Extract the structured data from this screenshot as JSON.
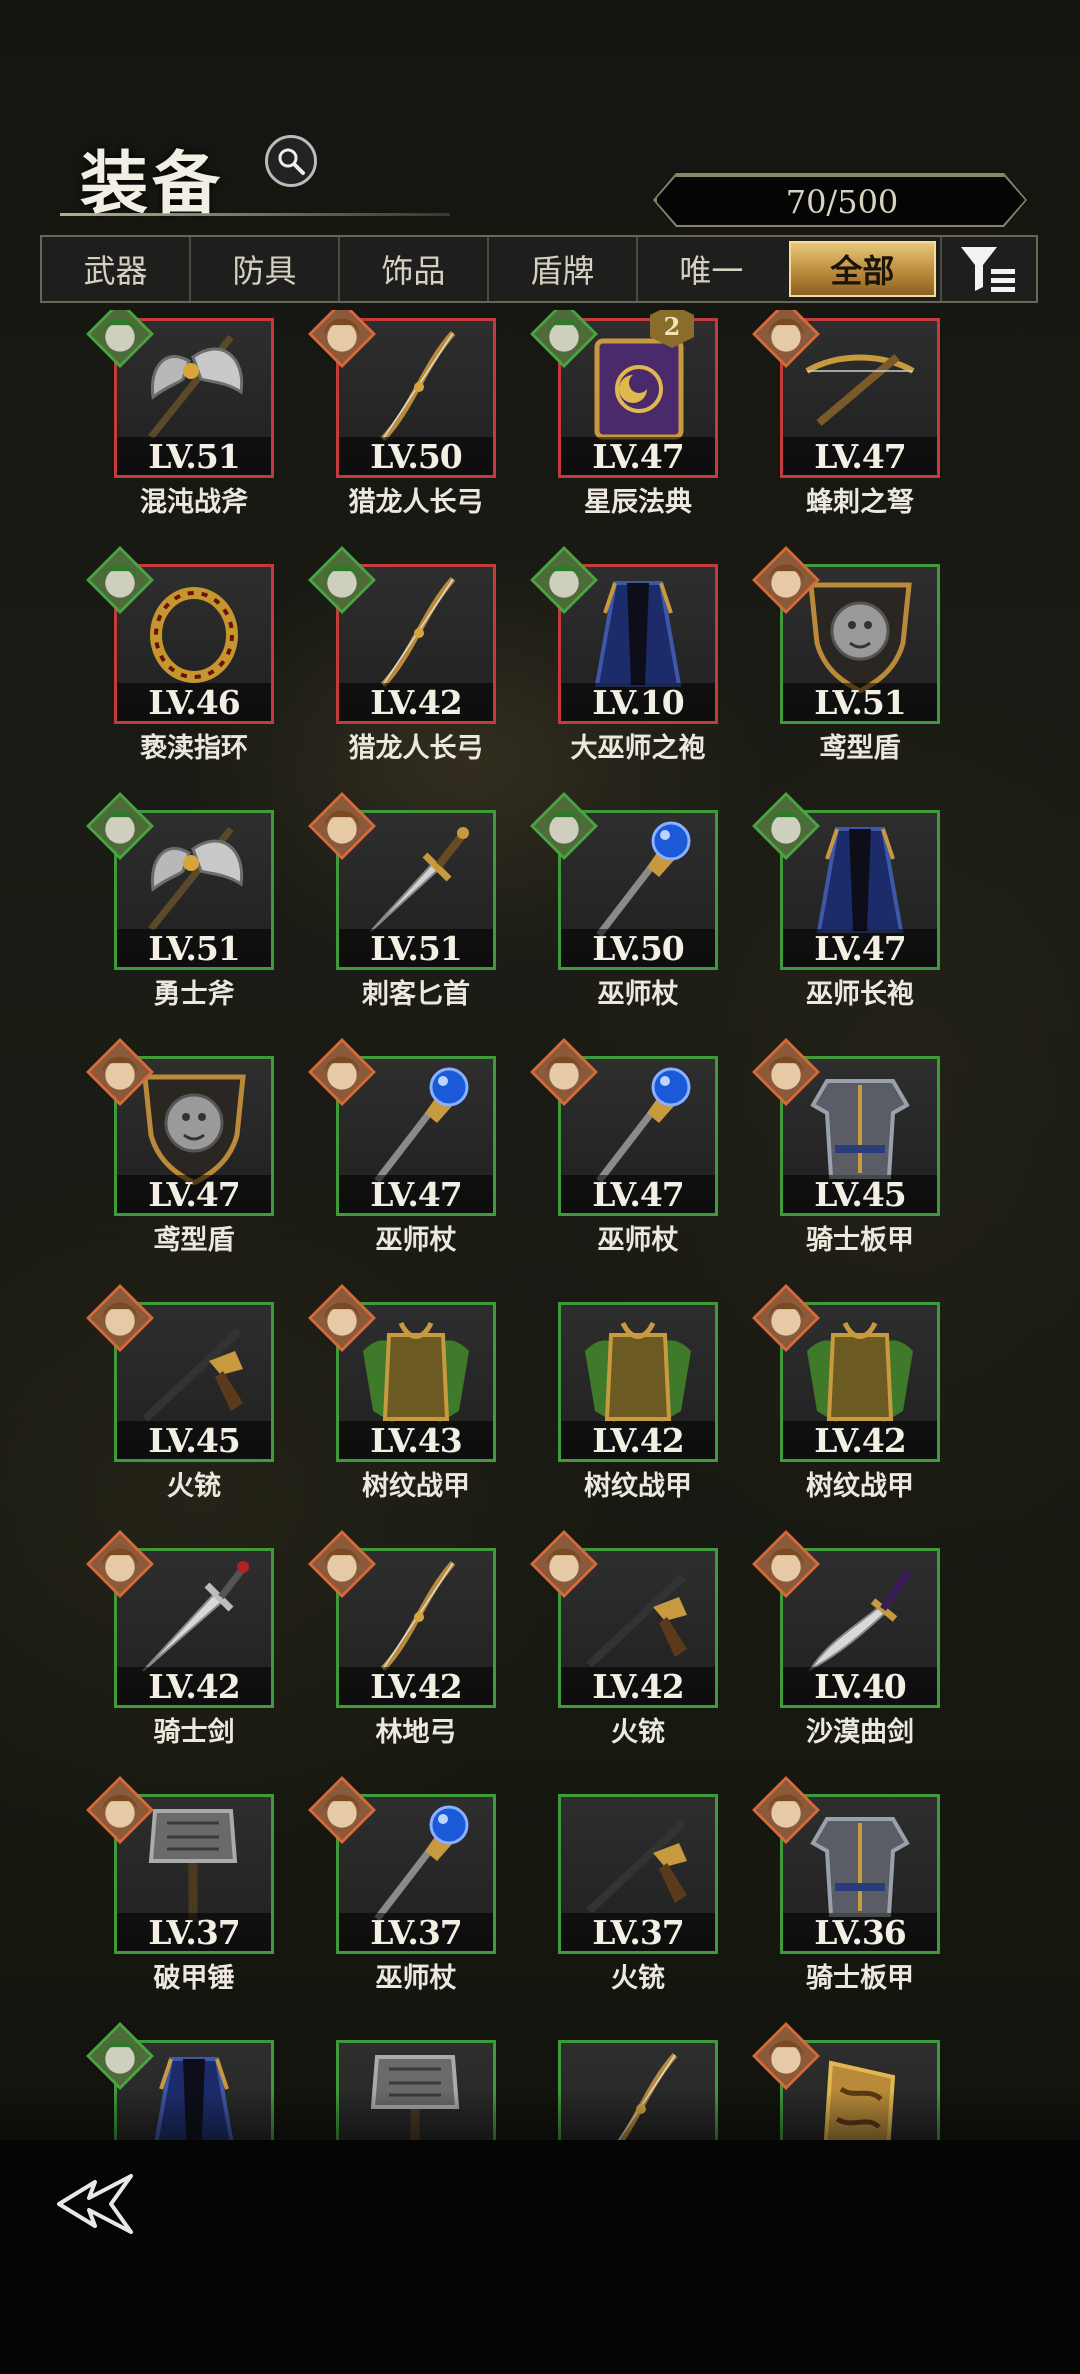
{
  "header": {
    "title": "装备",
    "count": "70/500"
  },
  "tabs": [
    {
      "label": "武器",
      "active": false
    },
    {
      "label": "防具",
      "active": false
    },
    {
      "label": "饰品",
      "active": false
    },
    {
      "label": "盾牌",
      "active": false
    },
    {
      "label": "唯一",
      "active": false
    },
    {
      "label": "全部",
      "active": true
    }
  ],
  "colors": {
    "accent_gold": "#c9994a",
    "rarity_green": "#3f9a3c",
    "rarity_red": "#c43b3b"
  },
  "items": [
    {
      "level": "LV.51",
      "name": "混沌战斧",
      "rarity": "red",
      "icon": "axe-icon",
      "hero": "green"
    },
    {
      "level": "LV.50",
      "name": "猎龙人长弓",
      "rarity": "red",
      "icon": "bow-icon",
      "hero": "red"
    },
    {
      "level": "LV.47",
      "name": "星辰法典",
      "rarity": "red",
      "icon": "tome-icon",
      "hero": "green",
      "badge": "2"
    },
    {
      "level": "LV.47",
      "name": "蜂刺之弩",
      "rarity": "red",
      "icon": "crossbow-icon",
      "hero": "red"
    },
    {
      "level": "LV.46",
      "name": "亵渎指环",
      "rarity": "red",
      "icon": "ring-icon",
      "hero": "green"
    },
    {
      "level": "LV.42",
      "name": "猎龙人长弓",
      "rarity": "red",
      "icon": "bow-icon",
      "hero": "green"
    },
    {
      "level": "LV.10",
      "name": "大巫师之袍",
      "rarity": "red",
      "icon": "robe-icon",
      "hero": "green"
    },
    {
      "level": "LV.51",
      "name": "鸢型盾",
      "rarity": "green",
      "icon": "shield-icon",
      "hero": "red"
    },
    {
      "level": "LV.51",
      "name": "勇士斧",
      "rarity": "green",
      "icon": "axe-icon",
      "hero": "green"
    },
    {
      "level": "LV.51",
      "name": "刺客匕首",
      "rarity": "green",
      "icon": "dagger-icon",
      "hero": "red"
    },
    {
      "level": "LV.50",
      "name": "巫师杖",
      "rarity": "green",
      "icon": "staff-icon",
      "hero": "green"
    },
    {
      "level": "LV.47",
      "name": "巫师长袍",
      "rarity": "green",
      "icon": "robe-icon",
      "hero": "green"
    },
    {
      "level": "LV.47",
      "name": "鸢型盾",
      "rarity": "green",
      "icon": "shield-icon",
      "hero": "red"
    },
    {
      "level": "LV.47",
      "name": "巫师杖",
      "rarity": "green",
      "icon": "staff-icon",
      "hero": "red"
    },
    {
      "level": "LV.47",
      "name": "巫师杖",
      "rarity": "green",
      "icon": "staff-icon",
      "hero": "red"
    },
    {
      "level": "LV.45",
      "name": "骑士板甲",
      "rarity": "green",
      "icon": "plate-armor-icon",
      "hero": "red"
    },
    {
      "level": "LV.45",
      "name": "火铳",
      "rarity": "green",
      "icon": "musket-icon",
      "hero": "red"
    },
    {
      "level": "LV.43",
      "name": "树纹战甲",
      "rarity": "green",
      "icon": "leaf-armor-icon",
      "hero": "red"
    },
    {
      "level": "LV.42",
      "name": "树纹战甲",
      "rarity": "green",
      "icon": "leaf-armor-icon",
      "hero": ""
    },
    {
      "level": "LV.42",
      "name": "树纹战甲",
      "rarity": "green",
      "icon": "leaf-armor-icon",
      "hero": "red"
    },
    {
      "level": "LV.42",
      "name": "骑士剑",
      "rarity": "green",
      "icon": "sword-icon",
      "hero": "red"
    },
    {
      "level": "LV.42",
      "name": "林地弓",
      "rarity": "green",
      "icon": "bow-icon",
      "hero": "red"
    },
    {
      "level": "LV.42",
      "name": "火铳",
      "rarity": "green",
      "icon": "musket-icon",
      "hero": "red"
    },
    {
      "level": "LV.40",
      "name": "沙漠曲剑",
      "rarity": "green",
      "icon": "scimitar-icon",
      "hero": "red"
    },
    {
      "level": "LV.37",
      "name": "破甲锤",
      "rarity": "green",
      "icon": "hammer-icon",
      "hero": "red"
    },
    {
      "level": "LV.37",
      "name": "巫师杖",
      "rarity": "green",
      "icon": "staff-icon",
      "hero": "red"
    },
    {
      "level": "LV.37",
      "name": "火铳",
      "rarity": "green",
      "icon": "musket-icon",
      "hero": ""
    },
    {
      "level": "LV.36",
      "name": "骑士板甲",
      "rarity": "green",
      "icon": "plate-armor-icon",
      "hero": "red"
    },
    {
      "level": "",
      "name": "",
      "rarity": "green",
      "icon": "robe-icon",
      "hero": "green"
    },
    {
      "level": "",
      "name": "",
      "rarity": "green",
      "icon": "hammer-icon",
      "hero": ""
    },
    {
      "level": "",
      "name": "",
      "rarity": "green",
      "icon": "bow-icon",
      "hero": ""
    },
    {
      "level": "",
      "name": "",
      "rarity": "green",
      "icon": "bracer-icon",
      "hero": "red"
    }
  ]
}
